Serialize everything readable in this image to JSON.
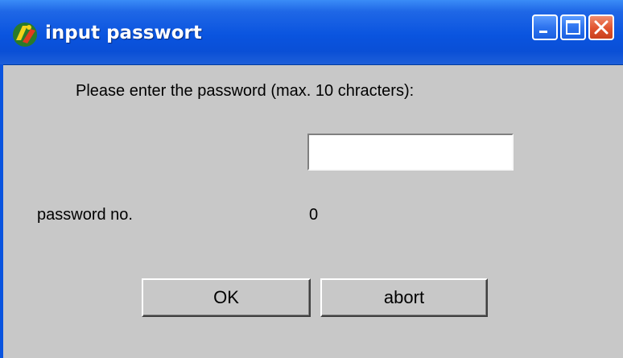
{
  "window": {
    "title": "input passwort",
    "app_icon": "app-logo-icon",
    "controls": [
      "minimize-icon",
      "maximize-icon",
      "close-icon"
    ]
  },
  "form": {
    "prompt": "Please enter the password (max. 10 chracters):",
    "password_value": "",
    "password_no_label": "password no.",
    "password_no_value": "0"
  },
  "buttons": {
    "ok_label": "OK",
    "abort_label": "abort"
  },
  "colors": {
    "titlebar": "#0a54df",
    "close_button": "#e0532e",
    "dialog_background": "#c8c8c8"
  }
}
